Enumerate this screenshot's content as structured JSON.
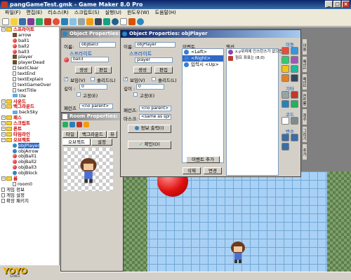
{
  "app": {
    "title": "pangGameTest.gmk - Game Maker 8.0 Pro",
    "window_buttons": [
      "_",
      "□",
      "×"
    ]
  },
  "menu": [
    "파일(F)",
    "편집(E)",
    "리소스(R)",
    "스크립트(S)",
    "실행(U)",
    "윈도우(W)",
    "도움말(H)"
  ],
  "tree": [
    {
      "label": "스프라이트",
      "kind": "folder",
      "indent": 0,
      "red": true
    },
    {
      "label": "arrow",
      "kind": "sprite",
      "indent": 2
    },
    {
      "label": "ball1",
      "kind": "redball",
      "indent": 2
    },
    {
      "label": "ball2",
      "kind": "redball",
      "indent": 2
    },
    {
      "label": "ball3",
      "kind": "redball",
      "indent": 2
    },
    {
      "label": "player",
      "kind": "sprite",
      "indent": 2
    },
    {
      "label": "playerDead",
      "kind": "sprite",
      "indent": 2
    },
    {
      "label": "textClear",
      "kind": "doc",
      "indent": 2
    },
    {
      "label": "textEnd",
      "kind": "doc",
      "indent": 2
    },
    {
      "label": "textExplain",
      "kind": "doc",
      "indent": 2
    },
    {
      "label": "textGameOver",
      "kind": "doc",
      "indent": 2
    },
    {
      "label": "textTitle",
      "kind": "doc",
      "indent": 2
    },
    {
      "label": "tile",
      "kind": "bg",
      "indent": 2
    },
    {
      "label": "사운드",
      "kind": "folder",
      "indent": 0,
      "red": true
    },
    {
      "label": "백그라운드",
      "kind": "folder",
      "indent": 0,
      "red": true
    },
    {
      "label": "backSky",
      "kind": "bg",
      "indent": 2
    },
    {
      "label": "패스",
      "kind": "folder",
      "indent": 0,
      "red": true
    },
    {
      "label": "스크립트",
      "kind": "folder",
      "indent": 0,
      "red": true
    },
    {
      "label": "폰트",
      "kind": "folder",
      "indent": 0,
      "red": true
    },
    {
      "label": "타임라인",
      "kind": "folder",
      "indent": 0,
      "red": true
    },
    {
      "label": "오브젝트",
      "kind": "folder",
      "indent": 0,
      "red": true
    },
    {
      "label": "objPlayer",
      "kind": "obj",
      "indent": 2,
      "selected": true
    },
    {
      "label": "objArrow",
      "kind": "obj",
      "indent": 2
    },
    {
      "label": "objBall1",
      "kind": "redball",
      "indent": 2
    },
    {
      "label": "objBall2",
      "kind": "redball",
      "indent": 2
    },
    {
      "label": "objBall3",
      "kind": "redball",
      "indent": 2
    },
    {
      "label": "objBlock",
      "kind": "obj",
      "indent": 2
    },
    {
      "label": "룸",
      "kind": "folder",
      "indent": 0,
      "red": true
    },
    {
      "label": "room0",
      "kind": "doc",
      "indent": 2
    },
    {
      "label": "게임 정보",
      "kind": "doc",
      "indent": 0
    },
    {
      "label": "게임 설정",
      "kind": "doc",
      "indent": 0
    },
    {
      "label": "확장 패키지",
      "kind": "doc",
      "indent": 0
    }
  ],
  "logo": {
    "main": "YOYO",
    "sub": "GAMES"
  },
  "obj_ball": {
    "title": "Object Properties: o",
    "name_label": "이름:",
    "name_value": "objBall3",
    "sprite_section": "스프라이트",
    "sprite_value": "ball3",
    "new_button": "생성",
    "edit_button": "편집",
    "visible_label": "보임(V)",
    "solid_label": "솔리드(L)",
    "depth_label": "깊이 :",
    "depth_value": "0",
    "persistent_label": "고정(E)",
    "parent_label": "페런츠",
    "parent_value": "<no parent>"
  },
  "room": {
    "title": "Room Properties: ro",
    "tabs": [
      "타일",
      "백그라운드",
      "뷰"
    ],
    "subtabs": [
      "오브젝트",
      "설정"
    ]
  },
  "obj_player": {
    "title": "Object Properties: objPlayer",
    "name_label": "이름:",
    "name_value": "objPlayer",
    "sprite_section": "스프라이트",
    "sprite_value": "player",
    "new_button": "생성",
    "edit_button": "편집",
    "visible_label": "보임(V)",
    "solid_label": "솔리드(L)",
    "depth_label": "깊이 :",
    "depth_value": "0",
    "persistent_label": "고정(E)",
    "parent_label": "페런츠:",
    "parent_value": "<no parent>",
    "mask_label": "마스크:",
    "mask_value": "<same as sprite>",
    "info_button": "정보 출력(I)",
    "ok_button": "확인(O)",
    "events_label": "이벤트",
    "events": [
      "<Left>",
      "<Right>",
      "입력시 <Up>"
    ],
    "selected_event": 1,
    "actions_label": "액션",
    "actions": [
      "x,y위치에 인스턴스가 없으면..",
      "점프 좌표는 (8,0)"
    ],
    "add_event_button": "이벤트 추가",
    "delete_button": "삭제",
    "change_button": "변경",
    "palette_sections": [
      "이동",
      "기타",
      "코드",
      "변수"
    ],
    "palette_tabs": [
      "이동",
      "메인1",
      "메인2",
      "컨트롤",
      "점수",
      "그리기",
      "추가"
    ]
  }
}
